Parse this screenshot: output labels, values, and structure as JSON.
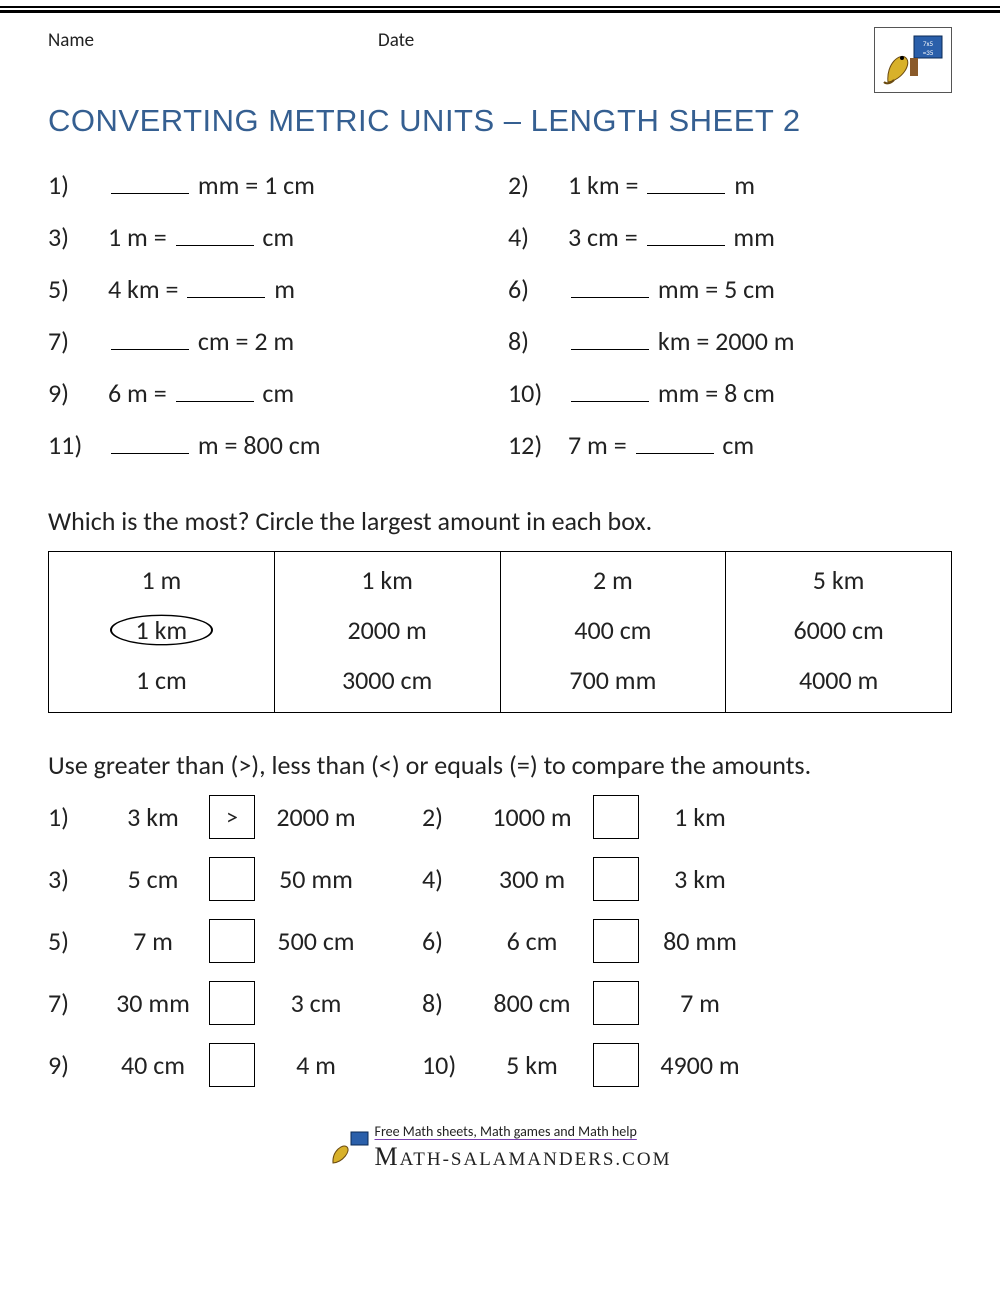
{
  "header": {
    "name_label": "Name",
    "date_label": "Date"
  },
  "title": "CONVERTING METRIC UNITS – LENGTH SHEET 2",
  "section1": {
    "items": [
      {
        "n": "1)",
        "pre": "",
        "post": " mm = 1 cm"
      },
      {
        "n": "2)",
        "pre": "1 km = ",
        "post": " m"
      },
      {
        "n": "3)",
        "pre": "1 m = ",
        "post": " cm"
      },
      {
        "n": "4)",
        "pre": "3 cm = ",
        "post": " mm"
      },
      {
        "n": "5)",
        "pre": "4 km = ",
        "post": " m"
      },
      {
        "n": "6)",
        "pre": "",
        "post": " mm = 5 cm"
      },
      {
        "n": "7)",
        "pre": "",
        "post": " cm = 2 m"
      },
      {
        "n": "8)",
        "pre": "",
        "post": " km = 2000 m"
      },
      {
        "n": "9)",
        "pre": "6 m = ",
        "post": " cm"
      },
      {
        "n": "10)",
        "pre": "",
        "post": " mm = 8 cm"
      },
      {
        "n": "11)",
        "pre": "",
        "post": " m = 800 cm"
      },
      {
        "n": "12)",
        "pre": "7 m = ",
        "post": " cm"
      }
    ]
  },
  "section2": {
    "instruction": "Which is the most? Circle the largest amount in each box.",
    "columns": [
      {
        "opts": [
          "1 m",
          "1 km",
          "1 cm"
        ],
        "circled": 1
      },
      {
        "opts": [
          "1 km",
          "2000 m",
          "3000 cm"
        ],
        "circled": -1
      },
      {
        "opts": [
          "2 m",
          "400 cm",
          "700 mm"
        ],
        "circled": -1
      },
      {
        "opts": [
          "5 km",
          "6000 cm",
          "4000 m"
        ],
        "circled": -1
      }
    ]
  },
  "section3": {
    "instruction": "Use greater than (>), less than (<) or equals (=) to compare the amounts.",
    "rows": [
      {
        "ln": "1)",
        "la": "3 km",
        "lans": ">",
        "lb": "2000 m",
        "rn": "2)",
        "ra": "1000 m",
        "rans": "",
        "rb": "1 km"
      },
      {
        "ln": "3)",
        "la": "5 cm",
        "lans": "",
        "lb": "50 mm",
        "rn": "4)",
        "ra": "300 m",
        "rans": "",
        "rb": "3 km"
      },
      {
        "ln": "5)",
        "la": "7 m",
        "lans": "",
        "lb": "500 cm",
        "rn": "6)",
        "ra": "6 cm",
        "rans": "",
        "rb": "80 mm"
      },
      {
        "ln": "7)",
        "la": "30 mm",
        "lans": "",
        "lb": "3 cm",
        "rn": "8)",
        "ra": "800 cm",
        "rans": "",
        "rb": "7 m"
      },
      {
        "ln": "9)",
        "la": "40 cm",
        "lans": "",
        "lb": "4 m",
        "rn": "10)",
        "ra": "5 km",
        "rans": "",
        "rb": "4900 m"
      }
    ]
  },
  "footer": {
    "tagline": "Free Math sheets, Math games and Math help",
    "brand": "ATH-SALAMANDERS.COM"
  }
}
